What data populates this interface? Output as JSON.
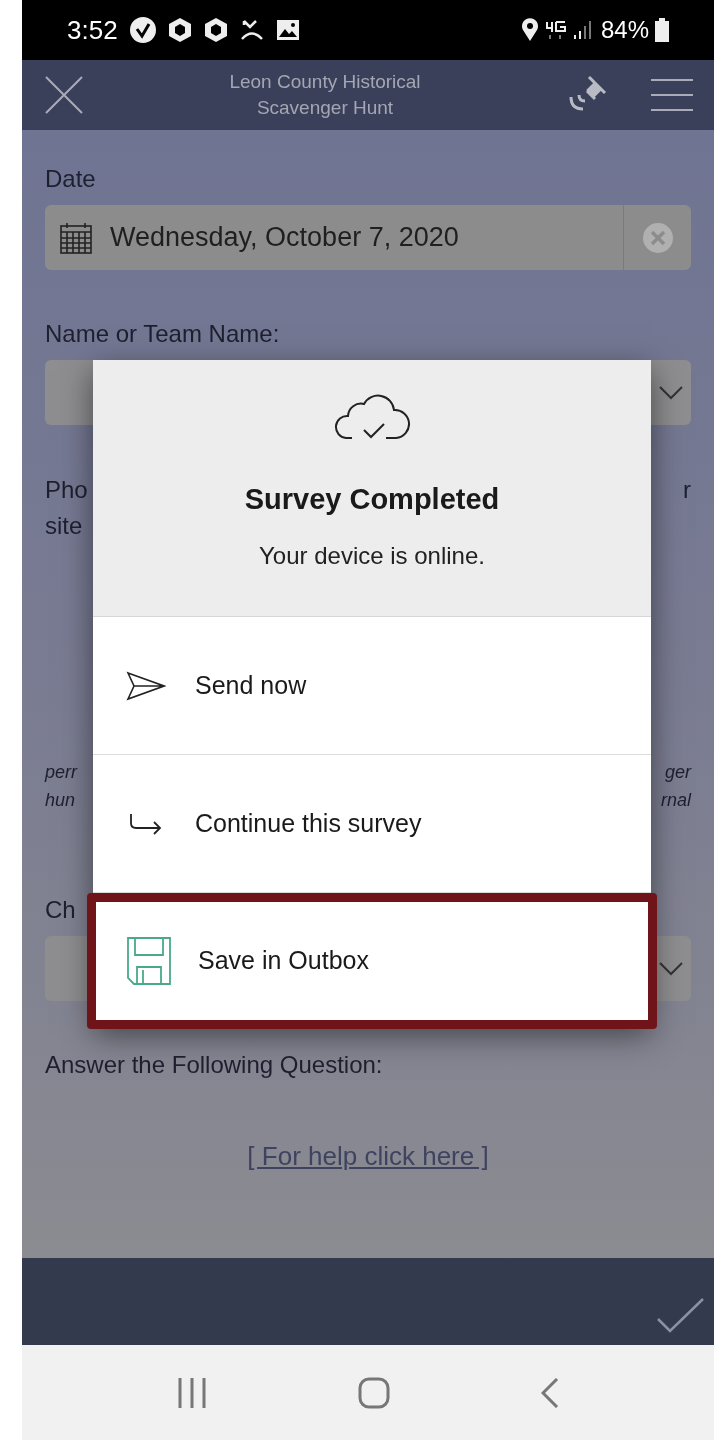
{
  "status_bar": {
    "time": "3:52",
    "battery": "84%"
  },
  "header": {
    "title_lines": [
      "Leon County Historical",
      "Scavenger Hunt"
    ]
  },
  "form": {
    "date": {
      "label": "Date",
      "value": "Wednesday, October 7, 2020"
    },
    "name": {
      "label": "Name or Team Name:"
    },
    "photo_question": {
      "left_lines": [
        "Pho",
        "site"
      ],
      "right_lines": [
        "r"
      ]
    },
    "photo_caption": {
      "left_lines": [
        "perr",
        "hun"
      ],
      "right_lines": [
        "ger",
        "rnal"
      ]
    },
    "choice": {
      "label": "Ch"
    },
    "question": {
      "label": "Answer the Following Question:",
      "link": "[ For help click here ]"
    }
  },
  "dialog": {
    "title": "Survey Completed",
    "message": "Your device is online.",
    "options": [
      {
        "kind": "send",
        "label": "Send now",
        "highlighted": false
      },
      {
        "kind": "continue",
        "label": "Continue this survey",
        "highlighted": false
      },
      {
        "kind": "save",
        "label": "Save in Outbox",
        "highlighted": true
      }
    ]
  }
}
